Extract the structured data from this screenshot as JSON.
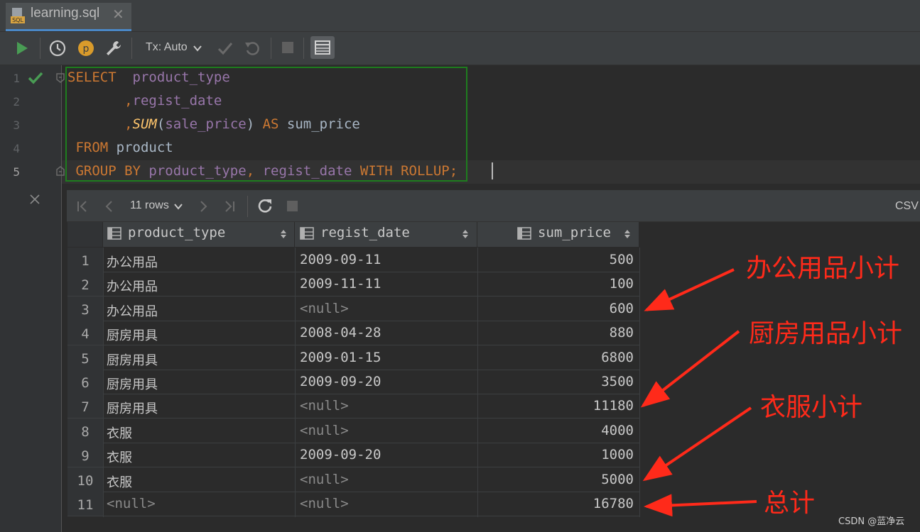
{
  "tab": {
    "label": "learning.sql",
    "close": "✕",
    "icon_text": "SQL"
  },
  "toolbar": {
    "tx_label": "Tx: Auto",
    "profile_letter": "p"
  },
  "editor": {
    "line_numbers": [
      "1",
      "2",
      "3",
      "4",
      "5"
    ],
    "lines": [
      [
        [
          "kw",
          "SELECT"
        ],
        [
          "plain",
          "  "
        ],
        [
          "col",
          "product_type"
        ]
      ],
      [
        [
          "plain",
          "       "
        ],
        [
          "kw",
          ","
        ],
        [
          "col",
          "regist_date"
        ]
      ],
      [
        [
          "plain",
          "       "
        ],
        [
          "kw",
          ","
        ],
        [
          "fn",
          "SUM"
        ],
        [
          "plain",
          "("
        ],
        [
          "col",
          "sale_price"
        ],
        [
          "plain",
          ") "
        ],
        [
          "kw",
          "AS"
        ],
        [
          "plain",
          " sum_price"
        ]
      ],
      [
        [
          "plain",
          " "
        ],
        [
          "kw",
          "FROM"
        ],
        [
          "plain",
          " product"
        ]
      ],
      [
        [
          "plain",
          " "
        ],
        [
          "kw",
          "GROUP BY"
        ],
        [
          "plain",
          " "
        ],
        [
          "col",
          "product_type"
        ],
        [
          "kw",
          ","
        ],
        [
          "plain",
          " "
        ],
        [
          "col",
          "regist_date"
        ],
        [
          "plain",
          " "
        ],
        [
          "kw",
          "WITH ROLLUP;"
        ]
      ]
    ]
  },
  "results": {
    "rows_label": "11 rows",
    "csv_label": "CSV",
    "columns": [
      "product_type",
      "regist_date",
      "sum_price"
    ],
    "rows": [
      [
        "办公用品",
        "2009-09-11",
        "500"
      ],
      [
        "办公用品",
        "2009-11-11",
        "100"
      ],
      [
        "办公用品",
        "<null>",
        "600"
      ],
      [
        "厨房用具",
        "2008-04-28",
        "880"
      ],
      [
        "厨房用具",
        "2009-01-15",
        "6800"
      ],
      [
        "厨房用具",
        "2009-09-20",
        "3500"
      ],
      [
        "厨房用具",
        "<null>",
        "11180"
      ],
      [
        "衣服",
        "<null>",
        "4000"
      ],
      [
        "衣服",
        "2009-09-20",
        "1000"
      ],
      [
        "衣服",
        "<null>",
        "5000"
      ],
      [
        "<null>",
        "<null>",
        "16780"
      ]
    ]
  },
  "annotations": {
    "office_subtotal": "办公用品小计",
    "kitchen_subtotal": "厨房用品小计",
    "clothes_subtotal": "衣服小计",
    "grand_total": "总计",
    "color": "#ff2a1a"
  },
  "watermark": "CSDN @蓝净云"
}
